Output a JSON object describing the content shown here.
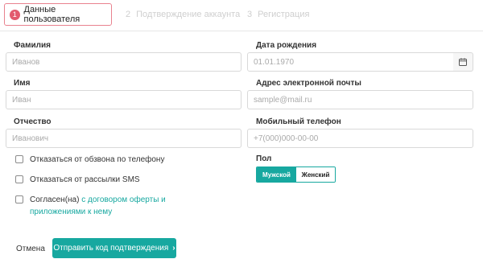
{
  "steps": [
    {
      "number": "1",
      "label": "Данные пользователя"
    },
    {
      "number": "2",
      "label": "Подтверждение аккаунта"
    },
    {
      "number": "3",
      "label": "Регистрация"
    }
  ],
  "form": {
    "last_name": {
      "label": "Фамилия",
      "placeholder": "Иванов"
    },
    "first_name": {
      "label": "Имя",
      "placeholder": "Иван"
    },
    "patronymic": {
      "label": "Отчество",
      "placeholder": "Иванович"
    },
    "birth_date": {
      "label": "Дата рождения",
      "placeholder": "01.01.1970",
      "icon": "calendar-icon"
    },
    "email": {
      "label": "Адрес электронной почты",
      "placeholder": "sample@mail.ru"
    },
    "phone": {
      "label": "Мобильный телефон",
      "placeholder": "+7(000)000-00-00"
    }
  },
  "checkboxes": {
    "no_calls": "Отказаться от обзвона по телефону",
    "no_sms": "Отказаться от рассылки SMS",
    "agree_prefix": "Согласен(на)",
    "agree_link_line1": "с договором оферты и",
    "agree_link_line2": "приложениями к нему"
  },
  "gender": {
    "label": "Пол",
    "options": [
      "Мужской",
      "Женский"
    ],
    "selected": "Мужской"
  },
  "actions": {
    "cancel": "Отмена",
    "submit": "Отправить код подтверждения"
  },
  "colors": {
    "accent": "#17a8a0",
    "step_active": "#e25a6e"
  }
}
